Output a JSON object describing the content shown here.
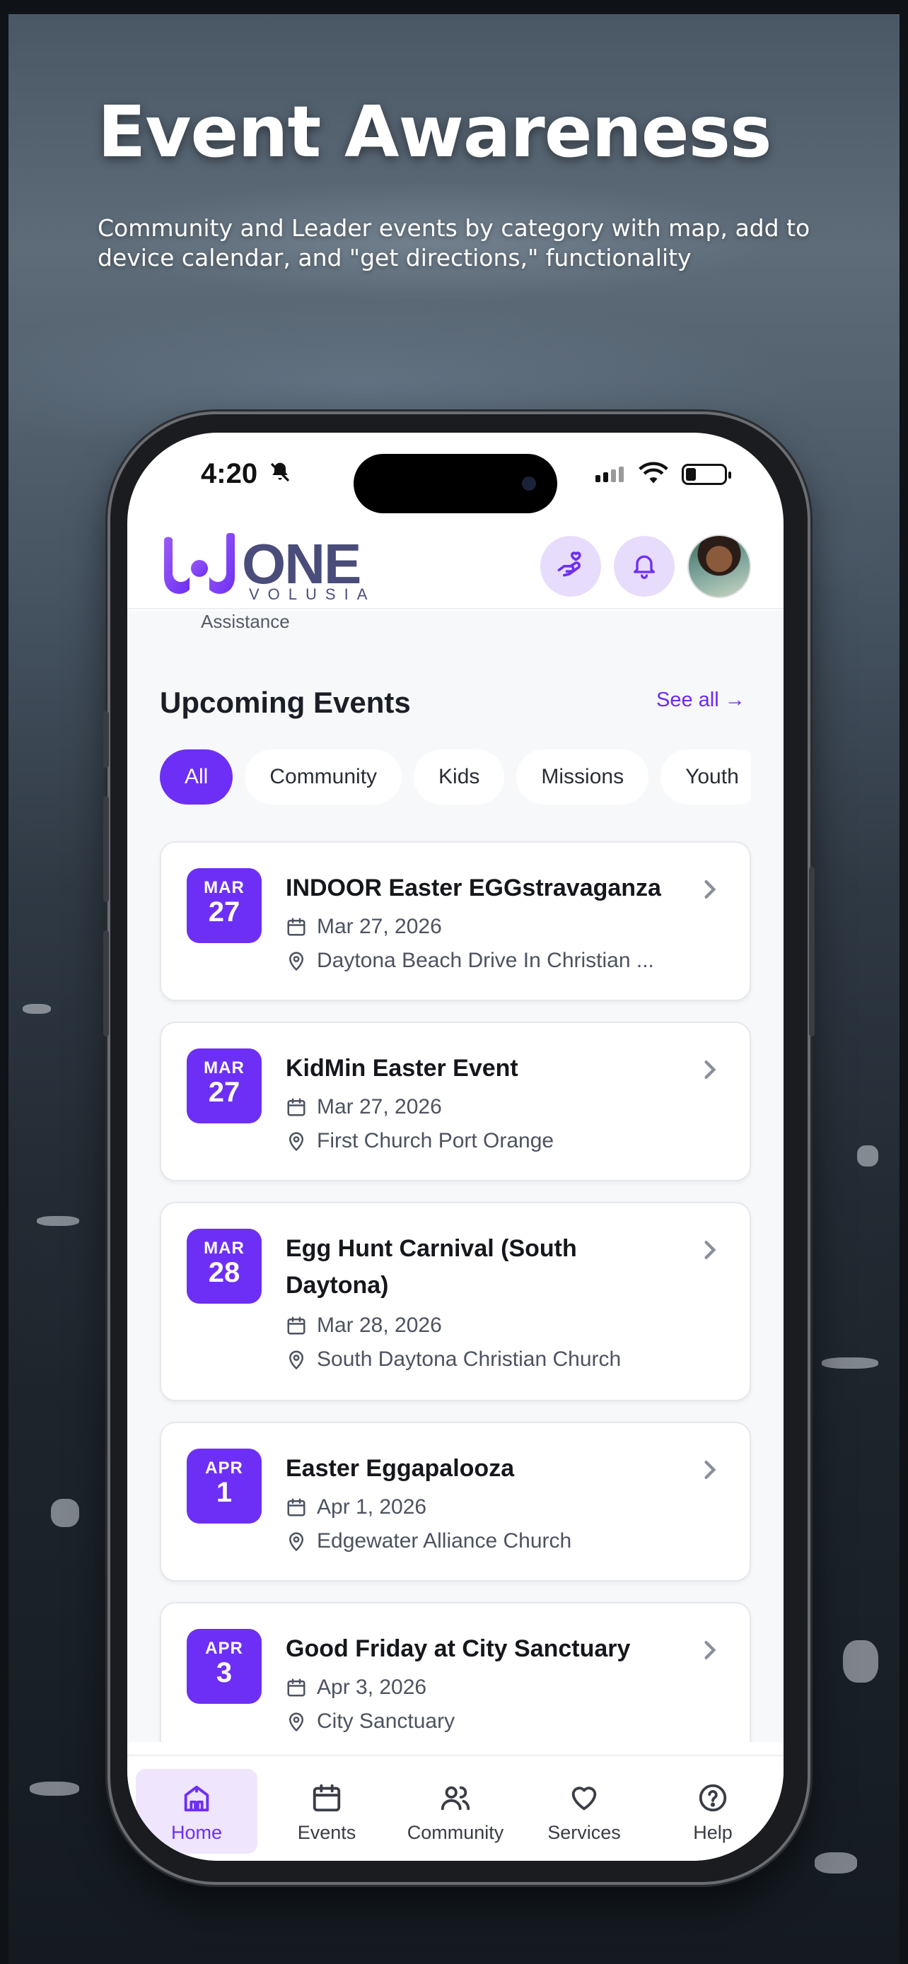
{
  "hero": {
    "title": "Event Awareness",
    "subtitle": "Community and Leader events by category with map, add to device calendar, and \"get directions,\" functionality"
  },
  "status_bar": {
    "time": "4:20"
  },
  "app_header": {
    "logo_text": "ONE",
    "logo_sub": "VOLUSIA",
    "icons": [
      "hand-heart-icon",
      "bell-icon"
    ]
  },
  "main": {
    "partial_label": "Assistance",
    "section_title": "Upcoming Events",
    "see_all": "See all →",
    "chips": [
      {
        "label": "All",
        "active": true
      },
      {
        "label": "Community",
        "active": false
      },
      {
        "label": "Kids",
        "active": false
      },
      {
        "label": "Missions",
        "active": false
      },
      {
        "label": "Youth",
        "active": false
      }
    ],
    "events": [
      {
        "month": "MAR",
        "day": "27",
        "title": "INDOOR Easter EGGstravaganza",
        "date": "Mar 27, 2026",
        "location": "Daytona Beach Drive In Christian ..."
      },
      {
        "month": "MAR",
        "day": "27",
        "title": "KidMin Easter Event",
        "date": "Mar 27, 2026",
        "location": "First Church Port Orange"
      },
      {
        "month": "MAR",
        "day": "28",
        "title": "Egg Hunt Carnival (South Daytona)",
        "date": "Mar 28, 2026",
        "location": "South Daytona Christian Church"
      },
      {
        "month": "APR",
        "day": "1",
        "title": "Easter Eggapalooza",
        "date": "Apr 1, 2026",
        "location": "Edgewater Alliance Church"
      },
      {
        "month": "APR",
        "day": "3",
        "title": "Good Friday at City Sanctuary",
        "date": "Apr 3, 2026",
        "location": "City Sanctuary"
      }
    ]
  },
  "tab_bar": {
    "tabs": [
      {
        "label": "Home",
        "icon": "home-icon",
        "active": true
      },
      {
        "label": "Events",
        "icon": "calendar-icon",
        "active": false
      },
      {
        "label": "Community",
        "icon": "users-icon",
        "active": false
      },
      {
        "label": "Services",
        "icon": "heart-icon",
        "active": false
      },
      {
        "label": "Help",
        "icon": "help-circle-icon",
        "active": false
      }
    ]
  },
  "colors": {
    "accent": "#6d2ff5",
    "accent_light": "#e8dcfc",
    "text_dark": "#15171d"
  }
}
